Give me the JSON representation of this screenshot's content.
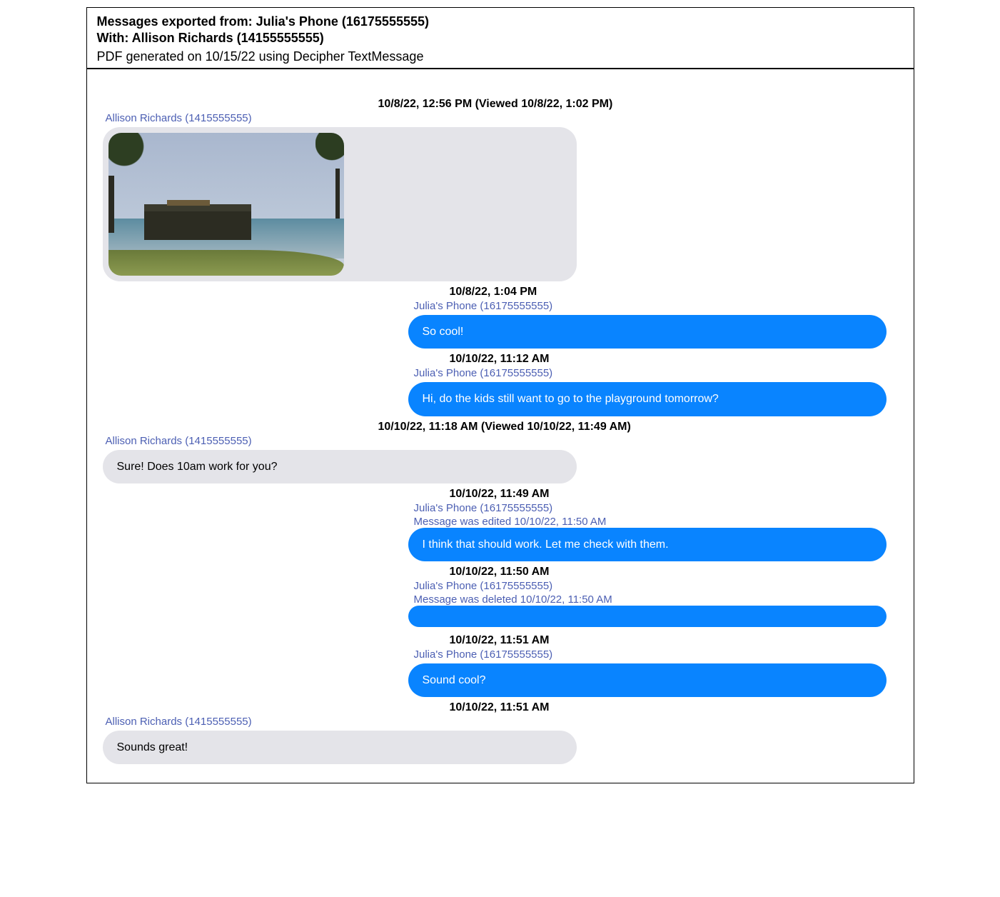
{
  "header": {
    "exported_from": "Messages exported from: Julia's Phone (16175555555)",
    "with": "With: Allison Richards (14155555555)",
    "generated": "PDF generated on 10/15/22 using Decipher TextMessage"
  },
  "senders": {
    "allison": "Allison Richards (1415555555)",
    "julia": "Julia's Phone (16175555555)"
  },
  "messages": {
    "m1": {
      "timestamp": "10/8/22, 12:56 PM (Viewed 10/8/22, 1:02 PM)",
      "sender_key": "allison",
      "type": "image"
    },
    "m2": {
      "timestamp": "10/8/22, 1:04 PM",
      "sender_key": "julia",
      "text": "So cool!"
    },
    "m3": {
      "timestamp": "10/10/22, 11:12 AM",
      "sender_key": "julia",
      "text": "Hi, do the kids still want to go to the playground tomorrow?"
    },
    "m4": {
      "timestamp": "10/10/22, 11:18 AM (Viewed 10/10/22, 11:49 AM)",
      "sender_key": "allison",
      "text": "Sure! Does 10am work for you?"
    },
    "m5": {
      "timestamp": "10/10/22, 11:49 AM",
      "sender_key": "julia",
      "meta": "Message was edited 10/10/22, 11:50 AM",
      "text": "I think that should work. Let me check with them."
    },
    "m6": {
      "timestamp": "10/10/22, 11:50 AM",
      "sender_key": "julia",
      "meta": "Message was deleted 10/10/22, 11:50 AM",
      "text": ""
    },
    "m7": {
      "timestamp": "10/10/22, 11:51 AM",
      "sender_key": "julia",
      "text": "Sound cool?"
    },
    "m8": {
      "timestamp": "10/10/22, 11:51 AM",
      "sender_key": "allison",
      "text": "Sounds great!"
    }
  }
}
